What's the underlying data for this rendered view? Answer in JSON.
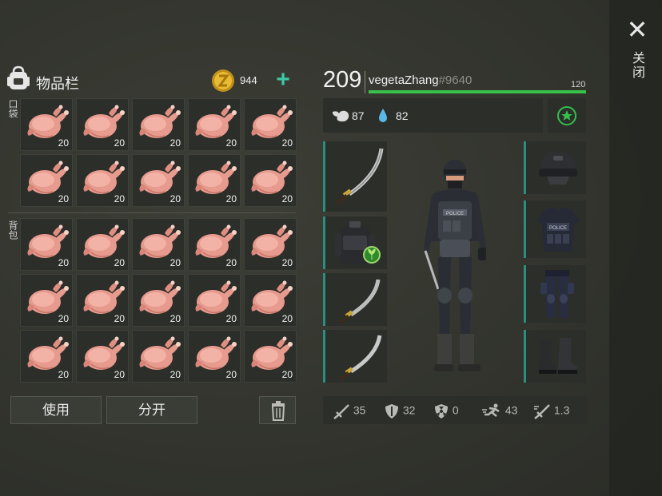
{
  "close": {
    "label": "关闭",
    "icon": "close-icon"
  },
  "inventory": {
    "title": "物品栏",
    "coins": "944",
    "pocket_label": "口袋",
    "backpack_label": "背包",
    "pocket_slots": [
      {
        "item": "raw-chicken",
        "qty": "20"
      },
      {
        "item": "raw-chicken",
        "qty": "20"
      },
      {
        "item": "raw-chicken",
        "qty": "20"
      },
      {
        "item": "raw-chicken",
        "qty": "20"
      },
      {
        "item": "raw-chicken",
        "qty": "20"
      },
      {
        "item": "raw-chicken",
        "qty": "20"
      },
      {
        "item": "raw-chicken",
        "qty": "20"
      },
      {
        "item": "raw-chicken",
        "qty": "20"
      },
      {
        "item": "raw-chicken",
        "qty": "20"
      },
      {
        "item": "raw-chicken",
        "qty": "20"
      }
    ],
    "backpack_slots": [
      {
        "item": "raw-chicken",
        "qty": "20"
      },
      {
        "item": "raw-chicken",
        "qty": "20"
      },
      {
        "item": "raw-chicken",
        "qty": "20"
      },
      {
        "item": "raw-chicken",
        "qty": "20"
      },
      {
        "item": "raw-chicken",
        "qty": "20"
      },
      {
        "item": "raw-chicken",
        "qty": "20"
      },
      {
        "item": "raw-chicken",
        "qty": "20"
      },
      {
        "item": "raw-chicken",
        "qty": "20"
      },
      {
        "item": "raw-chicken",
        "qty": "20"
      },
      {
        "item": "raw-chicken",
        "qty": "20"
      },
      {
        "item": "raw-chicken",
        "qty": "20"
      },
      {
        "item": "raw-chicken",
        "qty": "20"
      },
      {
        "item": "raw-chicken",
        "qty": "20"
      },
      {
        "item": "raw-chicken",
        "qty": "20"
      },
      {
        "item": "raw-chicken",
        "qty": "20"
      }
    ],
    "use_label": "使用",
    "split_label": "分开"
  },
  "player": {
    "level": "209",
    "name": "vegetaZhang",
    "tag": "#9640",
    "xp_max": "120",
    "xp_fraction": 1.0,
    "hunger": "87",
    "thirst": "82"
  },
  "equipment": {
    "weapons": [
      "katana",
      "backpack",
      "machete",
      "katana"
    ],
    "armor": [
      "swat-helmet",
      "swat-vest",
      "swat-pants",
      "combat-boots"
    ]
  },
  "attributes": {
    "attack": "35",
    "defense": "32",
    "radiation": "0",
    "speed": "43",
    "attack_speed": "1.3"
  },
  "colors": {
    "accent": "#3ec7a5",
    "xp_bar": "#38c24a",
    "gear_edge": "#2b8f80",
    "coin": "#e0b22c"
  }
}
